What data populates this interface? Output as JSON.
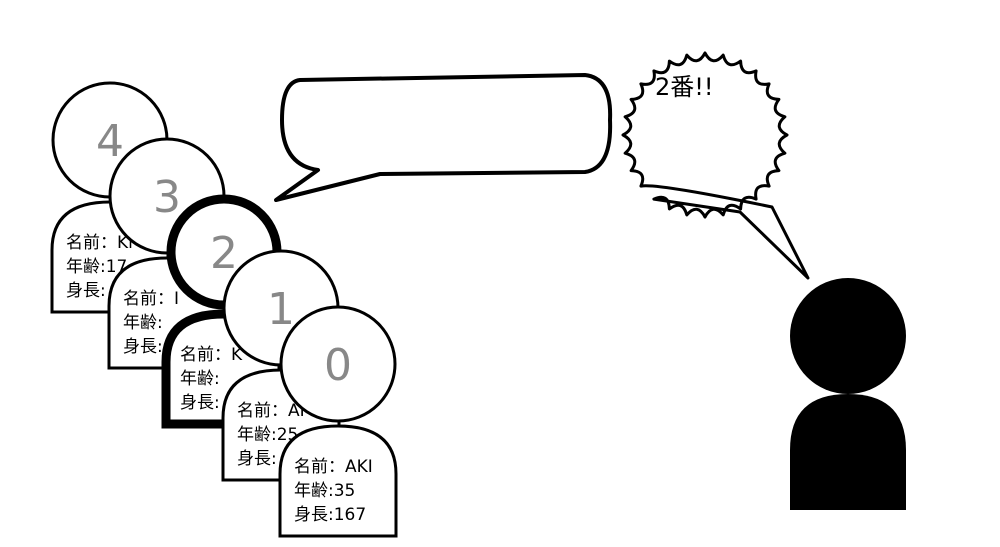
{
  "persons": [
    {
      "number": "4",
      "name": "名前：Kı",
      "age": "年齢:17",
      "height": "身長:"
    },
    {
      "number": "3",
      "name": "名前：I",
      "age": "年齢:",
      "height": "身長:"
    },
    {
      "number": "2",
      "name": "名前：K",
      "age": "年齢:",
      "height": "身長:",
      "highlighted": true
    },
    {
      "number": "1",
      "name": "名前：AI",
      "age": "年齢:25",
      "height": "身長:"
    },
    {
      "number": "0",
      "name": "名前：AKI",
      "age": "年齢:35",
      "height": "身長:167"
    }
  ],
  "speaker": {
    "shout": "2番!!"
  },
  "colors": {
    "outline": "#000000",
    "number": "#888888",
    "fill": "#ffffff",
    "speaker": "#000000"
  }
}
